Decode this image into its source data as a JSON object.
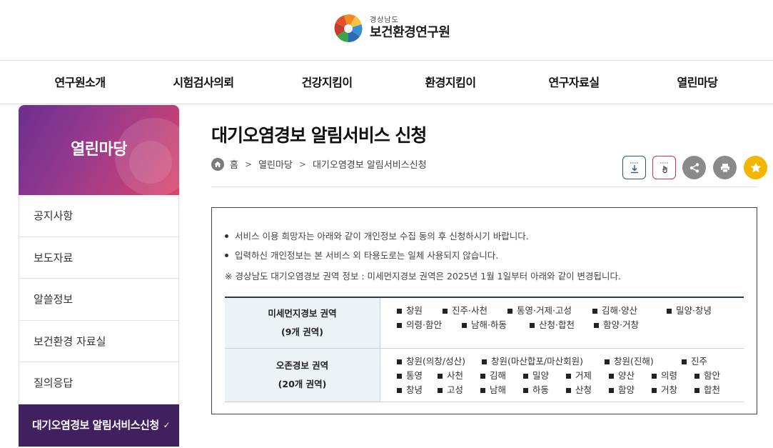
{
  "header": {
    "logo_sub": "경상남도",
    "logo_main": "보건환경연구원"
  },
  "gnb": [
    "연구원소개",
    "시험검사의뢰",
    "건강지킴이",
    "환경지킴이",
    "연구자료실",
    "열린마당"
  ],
  "sidebar": {
    "title": "열린마당",
    "items": [
      {
        "label": "공지사항"
      },
      {
        "label": "보도자료"
      },
      {
        "label": "알쓸정보"
      },
      {
        "label": "보건환경 자료실"
      },
      {
        "label": "질의응답"
      },
      {
        "label": "대기오염경보 알림서비스신청"
      }
    ],
    "active_index": 5
  },
  "page": {
    "title": "대기오염경보 알림서비스 신청",
    "breadcrumb": [
      "홈",
      "열린마당",
      "대기오염경보 알림서비스신청"
    ]
  },
  "tools": [
    {
      "icon": "download-icon",
      "color": "#2e5a7a"
    },
    {
      "icon": "touch-icon",
      "color": "#c0385a"
    },
    {
      "icon": "share-icon",
      "color": "#8a8a8a"
    },
    {
      "icon": "print-icon",
      "color": "#8a8a8a"
    },
    {
      "icon": "star-icon",
      "color": "#f2b600"
    }
  ],
  "notice": {
    "bullets": [
      "서비스 이용 희망자는 아래와 같이 개인정보 수집 동의 후 신청하시기 바랍니다.",
      "입력하신 개인정보는 본 서비스 외 타용도로는 일체 사용되지 않습니다."
    ],
    "note": "※ 경상남도 대기오염경보 권역 정보 : 미세먼지경보 권역은 2025년 1월 1일부터 아래와 같이 변경됩니다."
  },
  "regions": [
    {
      "name": "미세먼지경보 권역",
      "count": "(9개 권역)",
      "lines": [
        [
          "창원",
          "진주·사천",
          "통영·거제·고성",
          "김해·양산",
          "밀양·창녕"
        ],
        [
          "의령·함안",
          "남해·하동",
          "산청·합천",
          "함양·거창"
        ]
      ]
    },
    {
      "name": "오존경보 권역",
      "count": "(20개 권역)",
      "lines": [
        [
          "창원(의창/성산)",
          "창원(마산합포/마산회원)",
          "창원(진해)",
          "진주"
        ],
        [
          "통영",
          "사천",
          "김해",
          "밀양",
          "거제",
          "양산",
          "의령",
          "함안"
        ],
        [
          "창녕",
          "고성",
          "남해",
          "하동",
          "산청",
          "함양",
          "거창",
          "합천"
        ]
      ]
    }
  ],
  "colors": {
    "sidebar_active": "#40205f",
    "table_header_bg": "#ecf3f7"
  }
}
